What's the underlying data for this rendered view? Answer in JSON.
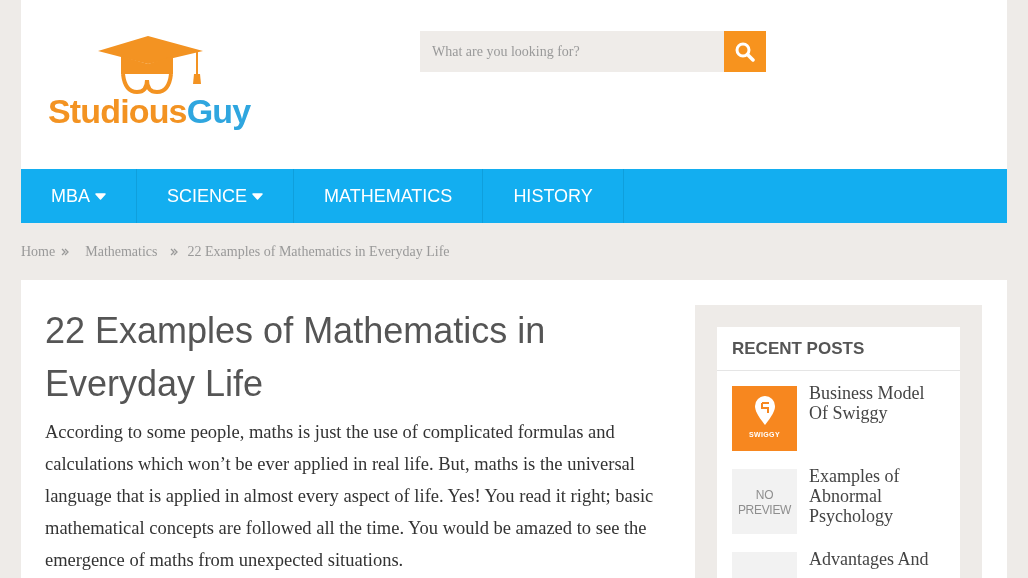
{
  "logo": {
    "parts": [
      {
        "text": "Studious",
        "color": "#f39322"
      },
      {
        "text": "Guy",
        "color": "#2fa6df"
      }
    ]
  },
  "search": {
    "placeholder": "What are you looking for?"
  },
  "nav": [
    {
      "label": "MBA",
      "dropdown": true
    },
    {
      "label": "SCIENCE",
      "dropdown": true
    },
    {
      "label": "MATHEMATICS",
      "dropdown": false
    },
    {
      "label": "HISTORY",
      "dropdown": false
    }
  ],
  "breadcrumb": [
    "Home",
    "Mathematics",
    "22 Examples of Mathematics in Everyday Life"
  ],
  "article": {
    "title": "22 Examples of Mathematics in Everyday Life",
    "body": "According to some people, maths is just the use of complicated formulas and calculations which won’t be ever applied in real life. But, maths is the universal language that is applied in almost every aspect of life. Yes! You read it right; basic mathematical concepts are followed all the time. You would be amazed to see the emergence of maths from unexpected situations."
  },
  "sidebar": {
    "heading": "RECENT POSTS",
    "posts": [
      {
        "title": "Business Model Of Swiggy",
        "thumb": {
          "kind": "logo",
          "text": "SWIGGY"
        }
      },
      {
        "title": "Examples of Abnormal Psychology",
        "thumb": {
          "kind": "placeholder",
          "lines": [
            "NO",
            "PREVIEW"
          ]
        }
      },
      {
        "title": "Advantages And",
        "thumb": {
          "kind": "placeholder"
        }
      }
    ]
  }
}
